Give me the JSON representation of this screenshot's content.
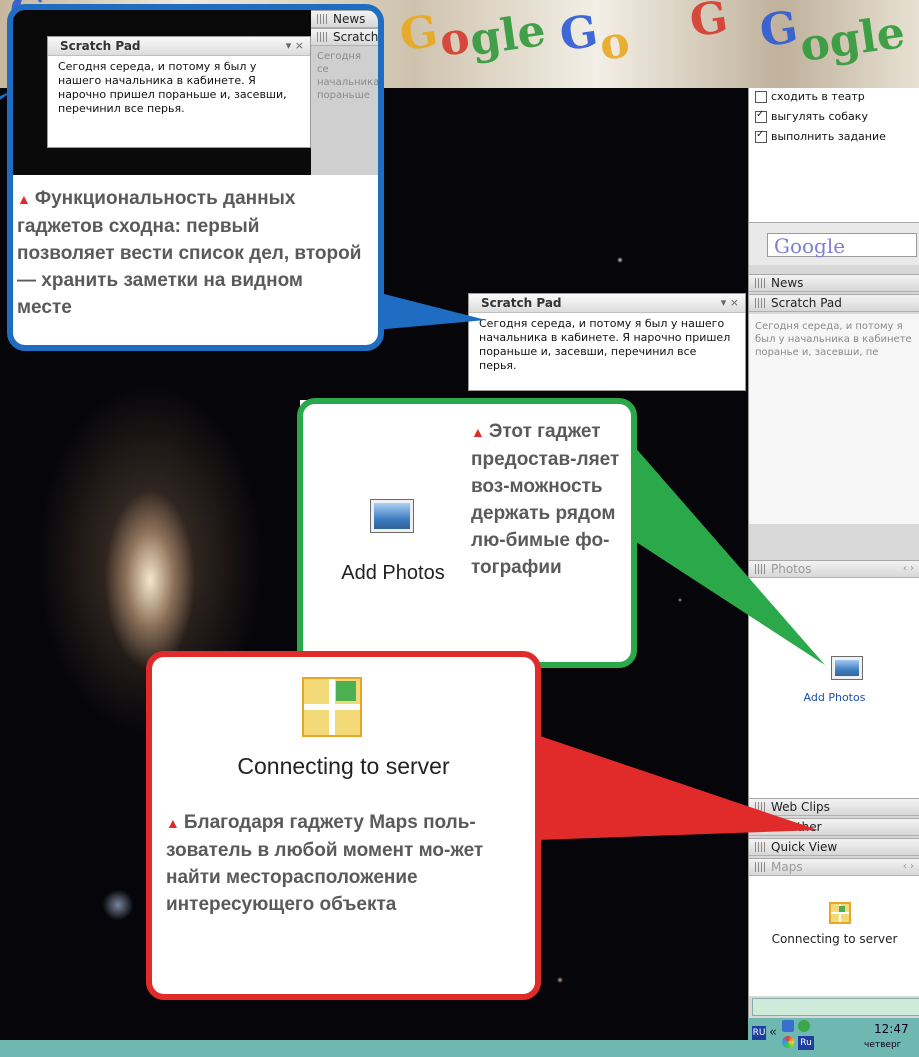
{
  "sidebar": {
    "todo_items": [
      {
        "label": "сходить в театр",
        "checked": false
      },
      {
        "label": "выгулять собаку",
        "checked": true
      },
      {
        "label": "выполнить задание",
        "checked": true
      }
    ],
    "google_text": "Google",
    "headers": {
      "news": "News",
      "scratch_pad": "Scratch Pad",
      "photos": "Photos",
      "web_clips": "Web Clips",
      "weather": "Weather",
      "quick_view": "Quick View",
      "maps": "Maps"
    },
    "scratch_preview": "Сегодня середа, и потому я был у начальника в кабинете поранье и, засевши, пе",
    "add_photos": "Add Photos",
    "connecting": "Connecting to server"
  },
  "tray": {
    "lang": "RU",
    "lang2": "Ru",
    "chevron": "«",
    "time": "12:47",
    "day": "четверг"
  },
  "scratch_floating": {
    "title": "Scratch Pad",
    "controls": "▾ ×",
    "text": "Сегодня середа, и потому я был у нашего начальника в кабинете. Я нарочно пришел пораньше и, засевши, перечинил все перья."
  },
  "callout_blue": {
    "mini_news": "News",
    "mini_scratch_title": "Scratch Pad",
    "mini_scratch_tab": "Scratch P",
    "mini_preview": "Сегодня се начальника пораньше",
    "text": "Функциональность данных гаджетов сходна: первый позволяет вести список дел, второй — хранить заметки на видном месте"
  },
  "callout_green": {
    "label": "Add Photos",
    "text": "Этот гаджет предостав-ляет воз-можность держать рядом лю-бимые фо-тографии"
  },
  "callout_red": {
    "label": "Connecting to server",
    "text": "Благодаря гаджету Maps поль-зователь в любой момент мо-жет найти месторасположение интересующего объекта"
  }
}
